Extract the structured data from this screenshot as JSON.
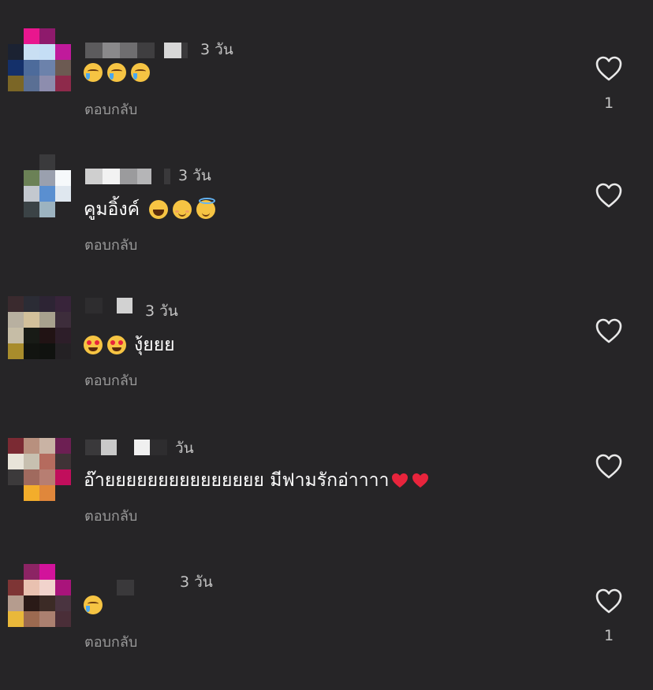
{
  "comments": [
    {
      "time": "3 วัน",
      "emojis": [
        "crying-face",
        "crying-face",
        "crying-face"
      ],
      "reply_label": "ตอบกลับ",
      "likes": "1"
    },
    {
      "time": "3 วัน",
      "text": "คูมอิ้งค์",
      "emojis": [
        "grinning-face",
        "smiling-face",
        "halo-face"
      ],
      "reply_label": "ตอบกลับ",
      "likes": ""
    },
    {
      "time": "3 วัน",
      "text": "งุ้ยยย",
      "emojis": [
        "heart-eyes-face",
        "heart-eyes-face"
      ],
      "reply_label": "ตอบกลับ",
      "likes": ""
    },
    {
      "time": "วัน",
      "text": "อ๊ายยยยยยยยยยยยยยย มีฟามรักอ่าาาา",
      "emojis": [
        "red-heart",
        "red-heart"
      ],
      "reply_label": "ตอบกลับ",
      "likes": ""
    },
    {
      "time": "3 วัน",
      "emojis": [
        "crying-face"
      ],
      "reply_label": "ตอบกลับ",
      "likes": "1"
    }
  ],
  "colors": {
    "background": "#262527",
    "text": "#ffffff",
    "secondary": "#9a9a9a",
    "timestamp": "#c4c4c4",
    "heart": "#e8243c"
  }
}
